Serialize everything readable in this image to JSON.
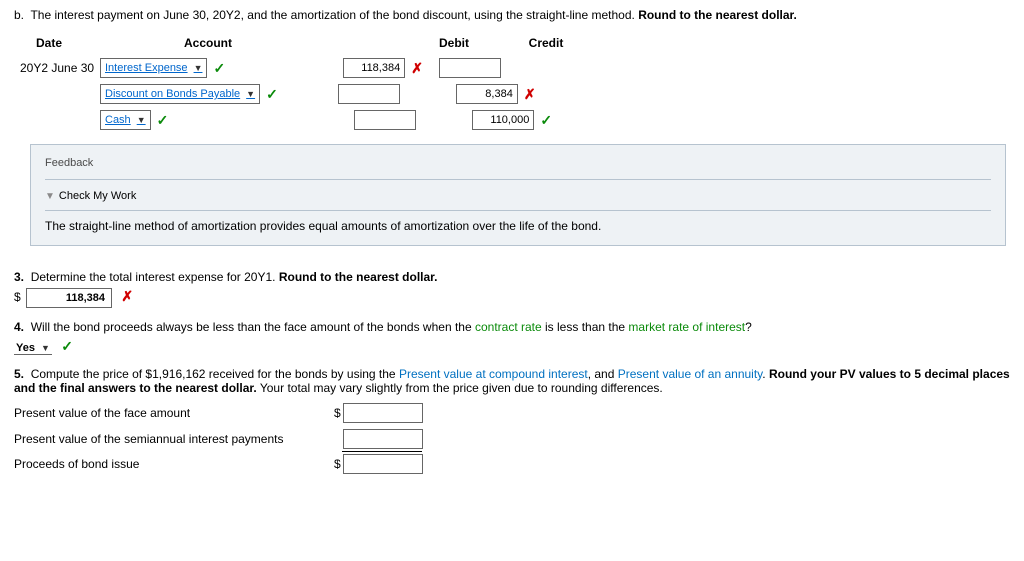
{
  "question_b": {
    "label": "b.",
    "text": "The interest payment on June 30, 20Y2, and the amortization of the bond discount, using the straight-line method. ",
    "bold": "Round to the nearest dollar.",
    "headers": {
      "date": "Date",
      "account": "Account",
      "debit": "Debit",
      "credit": "Credit"
    },
    "rows": [
      {
        "date": "20Y2 June 30",
        "account": "Interest Expense",
        "account_ok": true,
        "debit": "118,384",
        "debit_ok": false,
        "credit": "",
        "credit_ok": null
      },
      {
        "date": "",
        "account": "Discount on Bonds Payable",
        "account_ok": true,
        "debit": "",
        "debit_ok": null,
        "credit": "8,384",
        "credit_ok": false
      },
      {
        "date": "",
        "account": "Cash",
        "account_ok": true,
        "debit": "",
        "debit_ok": null,
        "credit": "110,000",
        "credit_ok": true
      }
    ]
  },
  "feedback": {
    "title": "Feedback",
    "check": "Check My Work",
    "text": "The straight-line method of amortization provides equal amounts of amortization over the life of the bond."
  },
  "q3": {
    "label": "3.",
    "text": "Determine the total interest expense for 20Y1. ",
    "bold": "Round to the nearest dollar.",
    "value": "118,384",
    "ok": false
  },
  "q4": {
    "label": "4.",
    "text_a": "Will the bond proceeds always be less than the face amount of the bonds when the ",
    "link1": "contract rate",
    "text_b": " is less than the ",
    "link2": "market rate of interest",
    "tail": "?",
    "value": "Yes",
    "ok": true
  },
  "q5": {
    "label": "5.",
    "text_a": "Compute the price of $1,916,162 received for the bonds by using the ",
    "link1": "Present value at compound interest",
    "text_b": ", and ",
    "link2": "Present value of an annuity",
    "text_c": ". ",
    "bold": "Round your PV values to 5 decimal places and the final answers to the nearest dollar.",
    "tail": " Your total may vary slightly from the price given due to rounding differences.",
    "rows": {
      "r1": "Present value of the face amount",
      "r2": "Present value of the semiannual interest payments",
      "r3": "Proceeds of bond issue"
    }
  }
}
